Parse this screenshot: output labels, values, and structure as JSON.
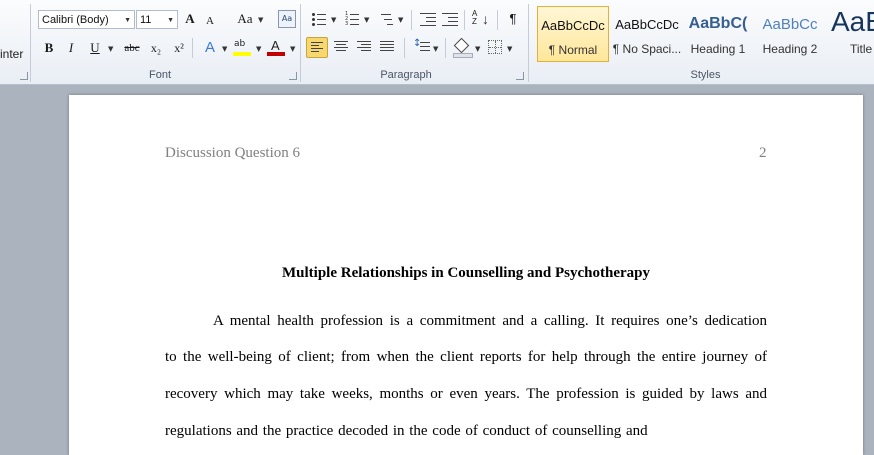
{
  "ribbon": {
    "clipboard": {
      "painter_label": "inter"
    },
    "font": {
      "font_name": "Calibri (Body)",
      "font_size": "11",
      "grow_icon": "A",
      "shrink_icon": "A",
      "change_case": "Aa",
      "bold": "B",
      "italic": "I",
      "underline": "U",
      "strike": "abc",
      "subscript": "x₂",
      "superscript": "x²",
      "text_effects": "A",
      "highlight": "ab",
      "font_color": "A",
      "group_label": "Font"
    },
    "paragraph": {
      "pilcrow": "¶",
      "group_label": "Paragraph"
    },
    "styles": {
      "items": [
        {
          "sample": "AaBbCcDc",
          "name": "¶ Normal"
        },
        {
          "sample": "AaBbCcDc",
          "name": "¶ No Spaci..."
        },
        {
          "sample": "AaBbC(",
          "name": "Heading 1"
        },
        {
          "sample": "AaBbCc",
          "name": "Heading 2"
        },
        {
          "sample": "AaB",
          "name": "Title"
        }
      ],
      "group_label": "Styles"
    }
  },
  "document": {
    "header_title": "Discussion Question 6",
    "page_number": "2",
    "title": "Multiple Relationships in Counselling and Psychotherapy",
    "lines": [
      "A mental health profession is a commitment and a calling. It requires one’s dedication",
      "to the well-being of client; from when the client reports for help through the entire journey of",
      "recovery which may take weeks, months or even years. The profession is guided by laws and",
      "regulations and the practice decoded in the code of conduct of counselling  and"
    ]
  },
  "colors": {
    "accent_selected": "#f7d76f",
    "heading_blue": "#365f91",
    "header_gray": "#7f7f7f"
  }
}
